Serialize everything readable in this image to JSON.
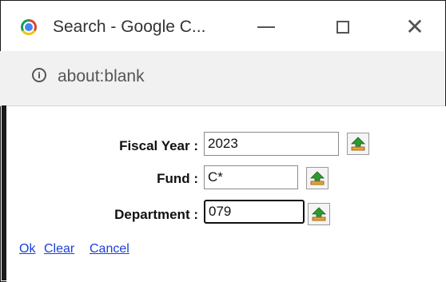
{
  "window": {
    "title": "Search - Google C...",
    "minimize_label": "—",
    "maximize_label": "☐",
    "close_label": "✕"
  },
  "address": {
    "url": "about:blank",
    "info_icon": "i"
  },
  "form": {
    "fiscal_year": {
      "label": "Fiscal Year :",
      "value": "2023"
    },
    "fund": {
      "label": "Fund :",
      "value": "C*"
    },
    "department": {
      "label": "Department :",
      "value": "079"
    }
  },
  "actions": {
    "ok": "Ok",
    "clear": "Clear",
    "cancel": "Cancel"
  },
  "colors": {
    "link": "#1a3ee0",
    "lookup_arrow": "#2e9a2e"
  },
  "icons": [
    "chrome-logo-icon",
    "minimize-icon",
    "maximize-icon",
    "close-icon",
    "info-icon",
    "lookup-arrow-icon"
  ]
}
